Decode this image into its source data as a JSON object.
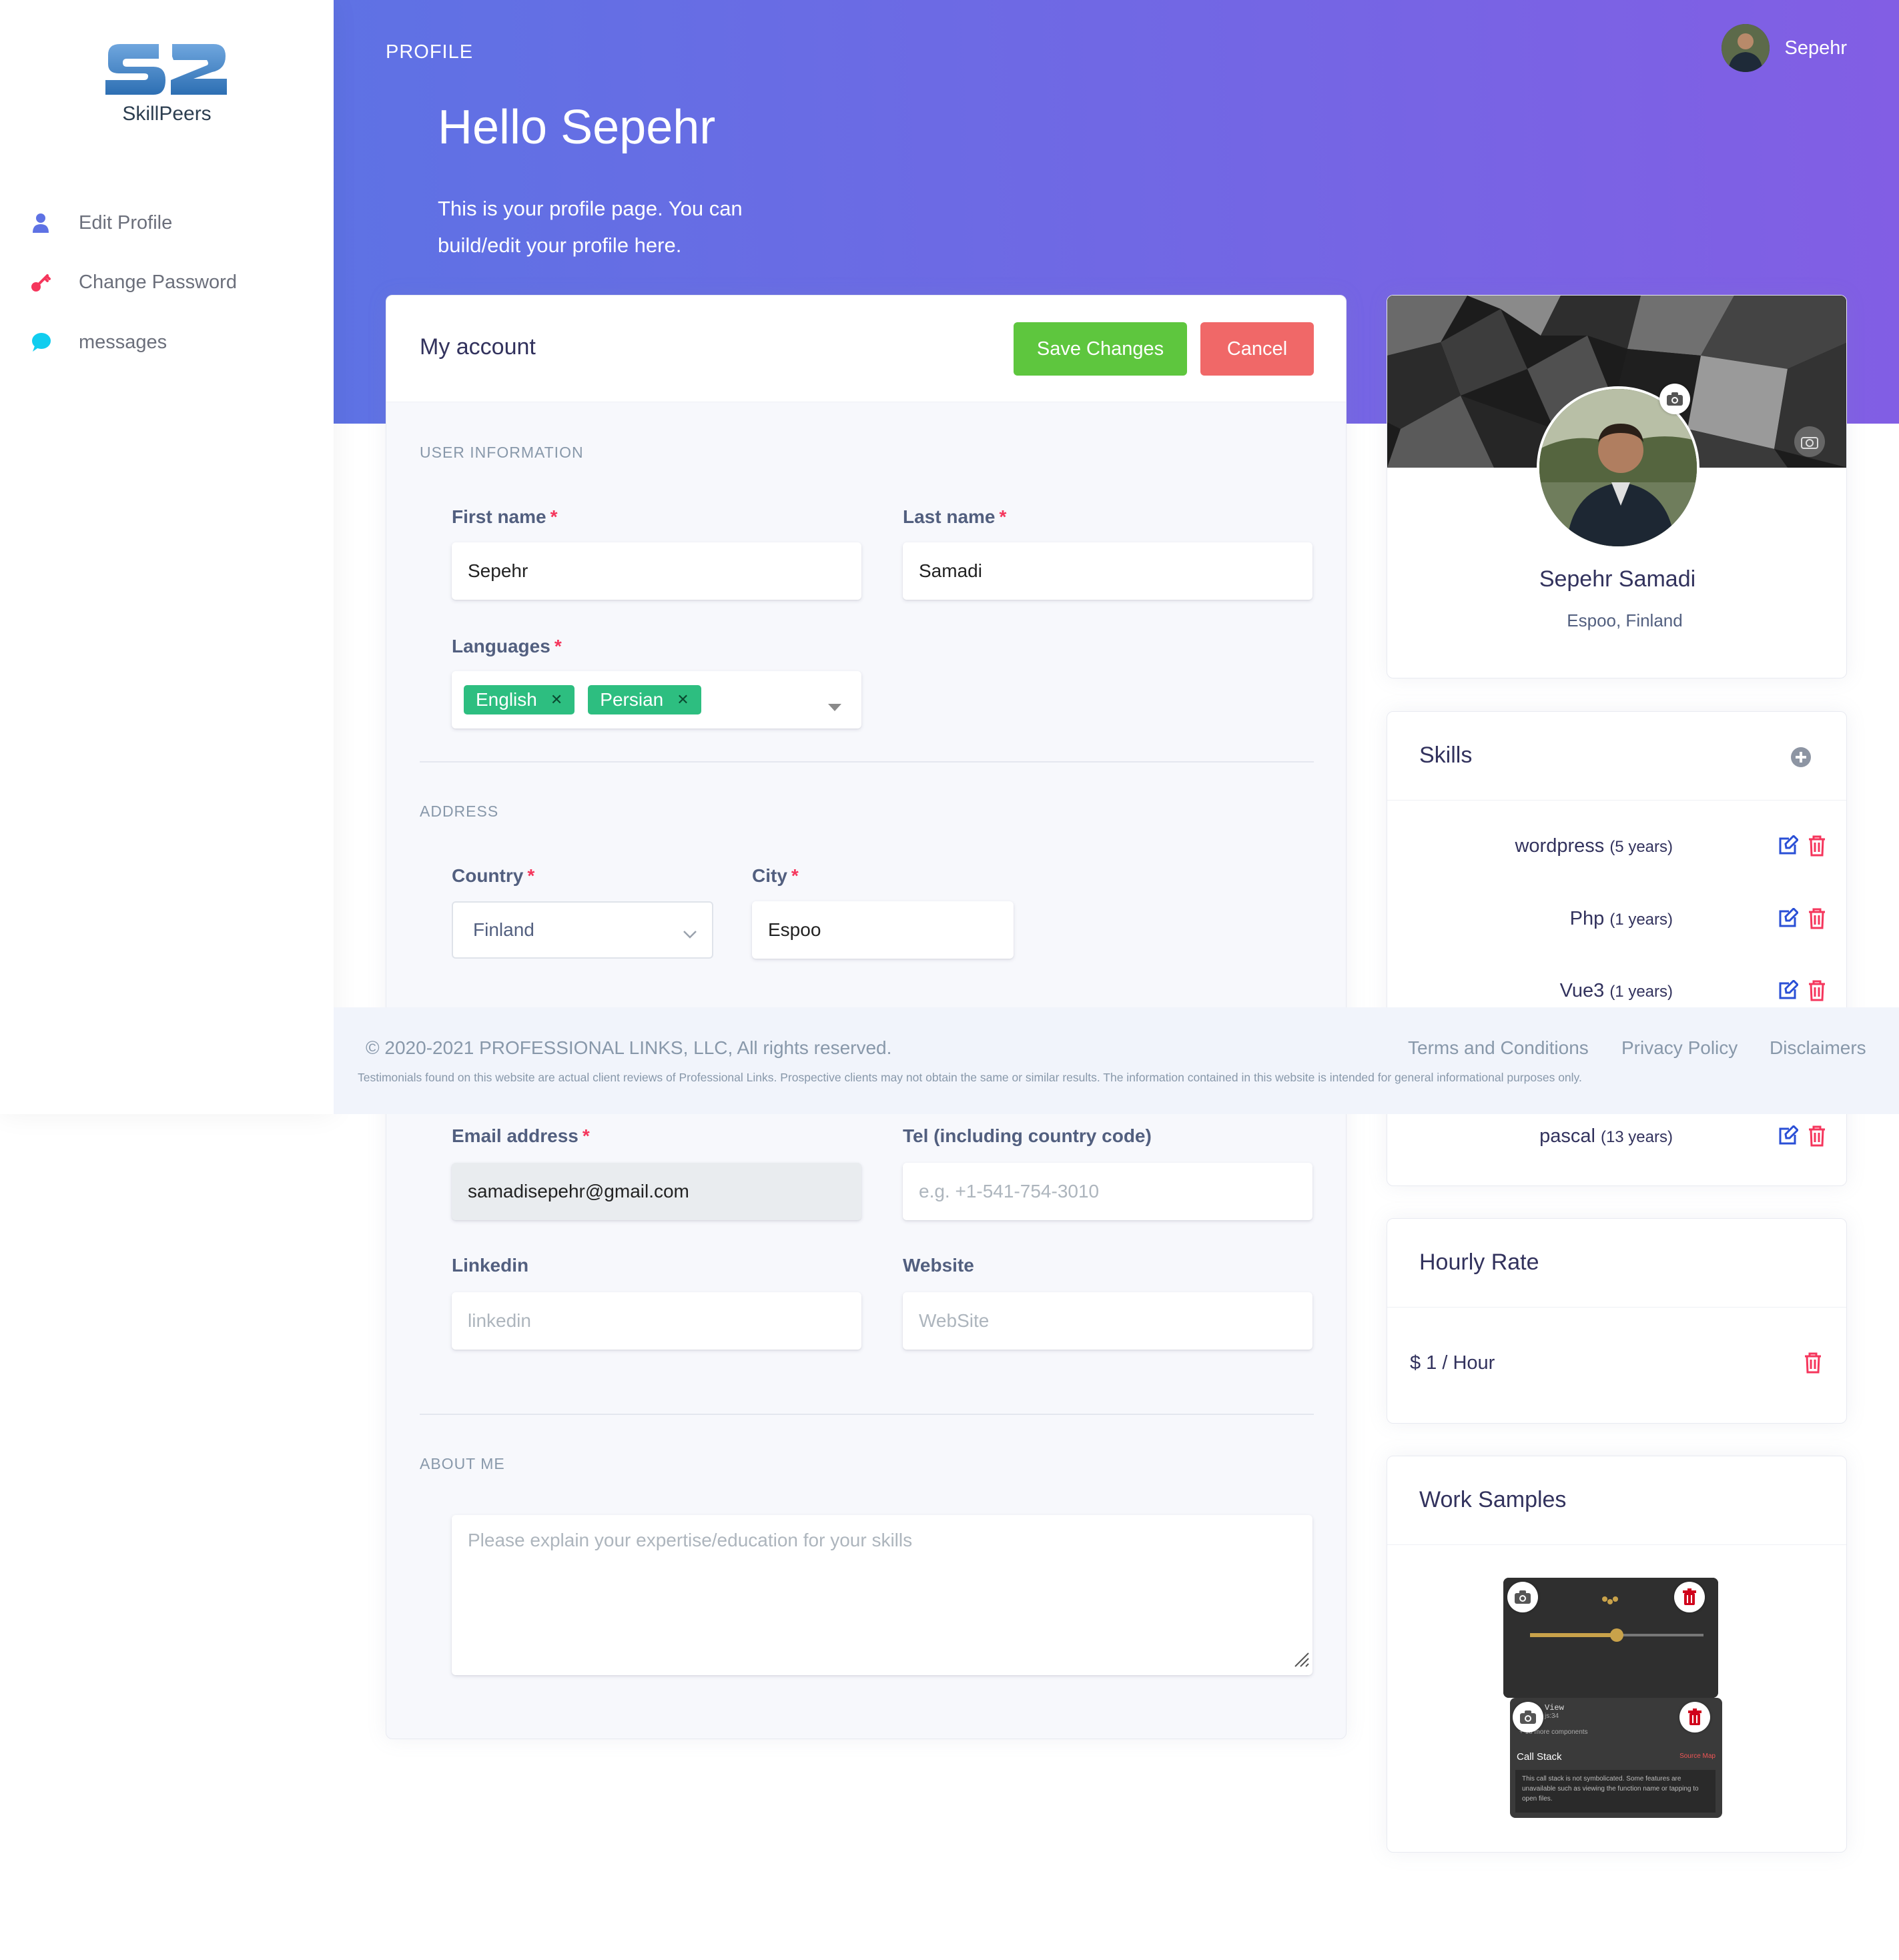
{
  "brand": {
    "name": "SkillPeers"
  },
  "sidebar": {
    "items": [
      {
        "label": "Edit Profile",
        "icon": "user-icon"
      },
      {
        "label": "Change Password",
        "icon": "key-icon"
      },
      {
        "label": "messages",
        "icon": "chat-bubble-icon"
      }
    ]
  },
  "header": {
    "section_label": "PROFILE",
    "greeting": "Hello Sepehr",
    "intro": "This is your profile page. You can build/edit your profile here.",
    "user_name": "Sepehr"
  },
  "account": {
    "title": "My account",
    "save_label": "Save Changes",
    "cancel_label": "Cancel",
    "user_info_title": "USER INFORMATION",
    "first_name": {
      "label": "First name",
      "value": "Sepehr"
    },
    "last_name": {
      "label": "Last name",
      "value": "Samadi"
    },
    "languages": {
      "label": "Languages",
      "tags": [
        "English",
        "Persian"
      ]
    },
    "address_title": "ADDRESS",
    "country": {
      "label": "Country",
      "value": "Finland"
    },
    "city": {
      "label": "City",
      "value": "Espoo"
    },
    "email": {
      "label": "Email address",
      "value": "samadisepehr@gmail.com"
    },
    "tel": {
      "label": "Tel (including country code)",
      "placeholder": "e.g. +1-541-754-3010"
    },
    "linkedin": {
      "label": "Linkedin",
      "placeholder": "linkedin"
    },
    "website": {
      "label": "Website",
      "placeholder": "WebSite"
    },
    "about_title": "ABOUT ME",
    "about": {
      "placeholder": "Please explain your expertise/education for your skills"
    }
  },
  "footer": {
    "copyright": "© 2020-2021 PROFESSIONAL LINKS, LLC, All rights reserved.",
    "links": [
      "Terms and Conditions",
      "Privacy Policy",
      "Disclaimers"
    ],
    "disclaimer": "Testimonials found on this website are actual client reviews of Professional Links. Prospective clients may not obtain the same or similar results. The information contained in this website is intended for general informational purposes only."
  },
  "profile_card": {
    "name": "Sepehr Samadi",
    "location": "Espoo, Finland"
  },
  "skills": {
    "title": "Skills",
    "items": [
      {
        "name": "wordpress",
        "years": "(5 years)"
      },
      {
        "name": "Php",
        "years": "(1 years)"
      },
      {
        "name": "Vue3",
        "years": "(1 years)"
      },
      {
        "name": "pascal",
        "years": "(13 years)"
      }
    ]
  },
  "hourly_rate": {
    "title": "Hourly Rate",
    "value": "$ 1 / Hour"
  },
  "work_samples": {
    "title": "Work Samples",
    "sample2": {
      "tag": "View",
      "line2": "js:34",
      "more": "+ 18 more components",
      "call_stack": "Call Stack",
      "source_map": "Source Map",
      "note": "This call stack is not symbolicated. Some features are unavailable such as viewing the function name or tapping to open files."
    }
  },
  "colors": {
    "primary": "#5e72e4",
    "secondary": "#825ee4",
    "success": "#5ec63e",
    "danger": "#f06868",
    "tag": "#2dbe80"
  }
}
